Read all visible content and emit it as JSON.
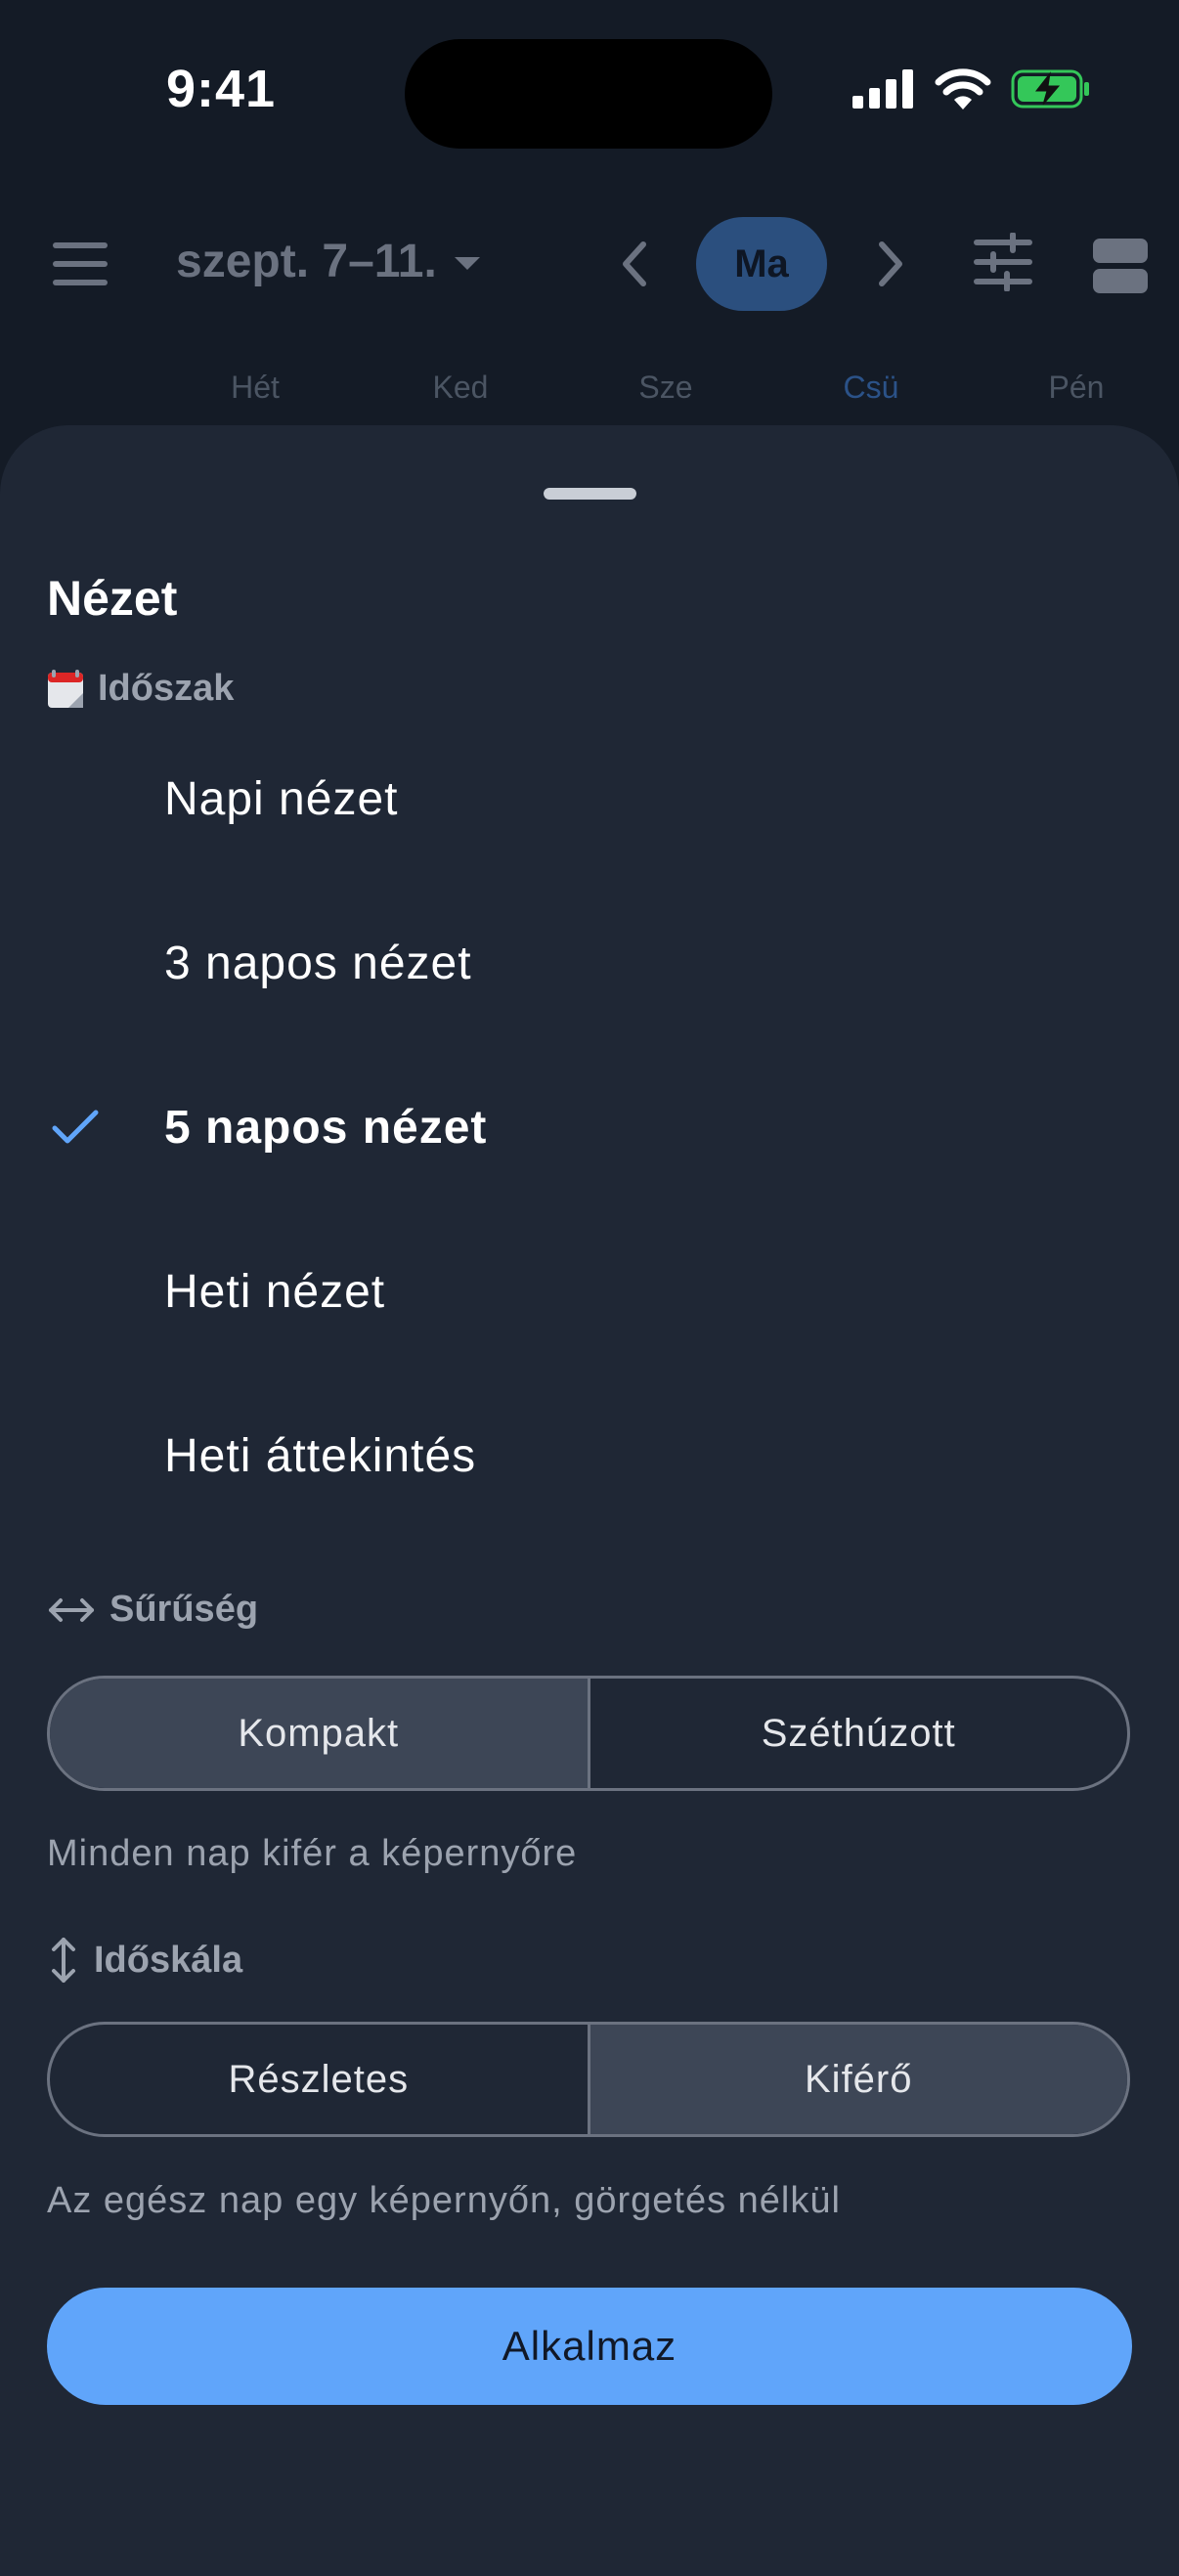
{
  "status_bar": {
    "time": "9:41",
    "icons": [
      "signal-icon",
      "wifi-icon",
      "battery-charging-icon"
    ],
    "battery_color": "#34c759"
  },
  "header": {
    "menu_icon": "hamburger-menu-icon",
    "date_range": "szept. 7–11.",
    "today_label": "Ma",
    "icons": [
      "chevron-left-icon",
      "chevron-right-icon",
      "sliders-icon",
      "layout-rows-icon"
    ]
  },
  "day_headers": [
    {
      "label": "Hét",
      "active": false
    },
    {
      "label": "Ked",
      "active": false
    },
    {
      "label": "Sze",
      "active": false
    },
    {
      "label": "Csü",
      "active": true
    },
    {
      "label": "Pén",
      "active": false
    }
  ],
  "sheet": {
    "title": "Nézet",
    "period": {
      "label": "Időszak",
      "icon": "calendar-icon",
      "options": [
        {
          "label": "Napi nézet",
          "selected": false
        },
        {
          "label": "3 napos nézet",
          "selected": false
        },
        {
          "label": "5 napos nézet",
          "selected": true
        },
        {
          "label": "Heti nézet",
          "selected": false
        },
        {
          "label": "Heti áttekintés",
          "selected": false
        }
      ]
    },
    "density": {
      "label": "Sűrűség",
      "icon": "horizontal-arrows-icon",
      "options": [
        "Kompakt",
        "Széthúzott"
      ],
      "selected": "Kompakt",
      "hint": "Minden nap kifér a képernyőre"
    },
    "timescale": {
      "label": "Időskála",
      "icon": "vertical-arrows-icon",
      "options": [
        "Részletes",
        "Kiférő"
      ],
      "selected": "Kiférő",
      "hint": "Az egész nap egy képernyőn, görgetés nélkül"
    },
    "apply_label": "Alkalmaz"
  },
  "colors": {
    "accent": "#60a5fa",
    "sheet_bg": "#1f2735",
    "background": "#141b26"
  }
}
